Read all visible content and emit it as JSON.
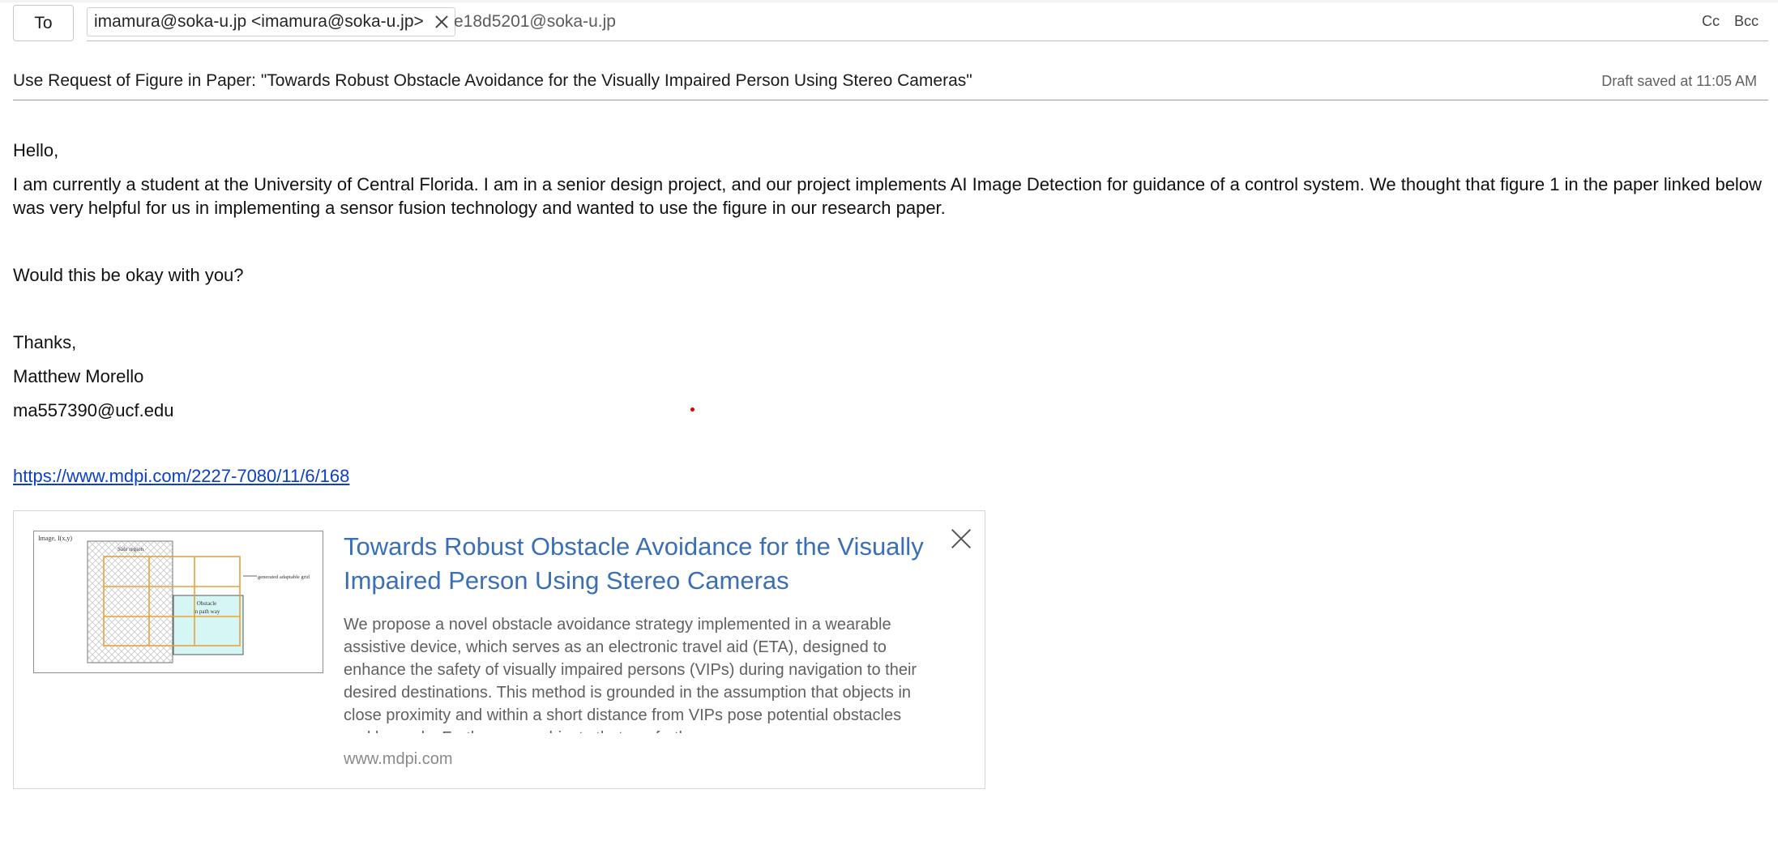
{
  "compose": {
    "to_label": "To",
    "recipients": [
      {
        "display": "imamura@soka-u.jp <imamura@soka-u.jp>"
      }
    ],
    "typed_recipient": "e18d5201@soka-u.jp",
    "cc_label": "Cc",
    "bcc_label": "Bcc",
    "subject": "Use Request of Figure in Paper: \"Towards Robust Obstacle Avoidance for the Visually Impaired Person Using Stereo Cameras\"",
    "draft_status": "Draft saved at 11:05 AM"
  },
  "body": {
    "greeting": "Hello,",
    "paragraph": "I am currently a student at the University of Central Florida. I am in a senior design project, and our project implements AI Image Detection for guidance of a control system. We thought that figure 1 in the paper linked below was very helpful for us in implementing a sensor fusion technology and wanted to use the figure in our research paper.",
    "question": "Would this be okay with you?",
    "closing": "Thanks,",
    "name": "Matthew Morello",
    "email": "ma557390@ucf.edu",
    "link": "https://www.mdpi.com/2227-7080/11/6/168"
  },
  "preview": {
    "title": "Towards Robust Obstacle Avoidance for the Visually Impaired Person Using Stereo Cameras",
    "description": "We propose a novel obstacle avoidance strategy implemented in a wearable assistive device, which serves as an electronic travel aid (ETA), designed to enhance the safety of visually impaired persons (VIPs) during navigation to their desired destinations. This method is grounded in the assumption that objects in close proximity and within a short distance from VIPs pose potential obstacles and hazards. Furthermore, objects that are farther away",
    "domain": "www.mdpi.com",
    "figure": {
      "image_label": "Image, I(x,y)",
      "safe_label": "Safe region",
      "grid_label": "generated adaptable grid",
      "obstacle_label_1": "Obstacle",
      "obstacle_label_2": "in path way"
    }
  }
}
